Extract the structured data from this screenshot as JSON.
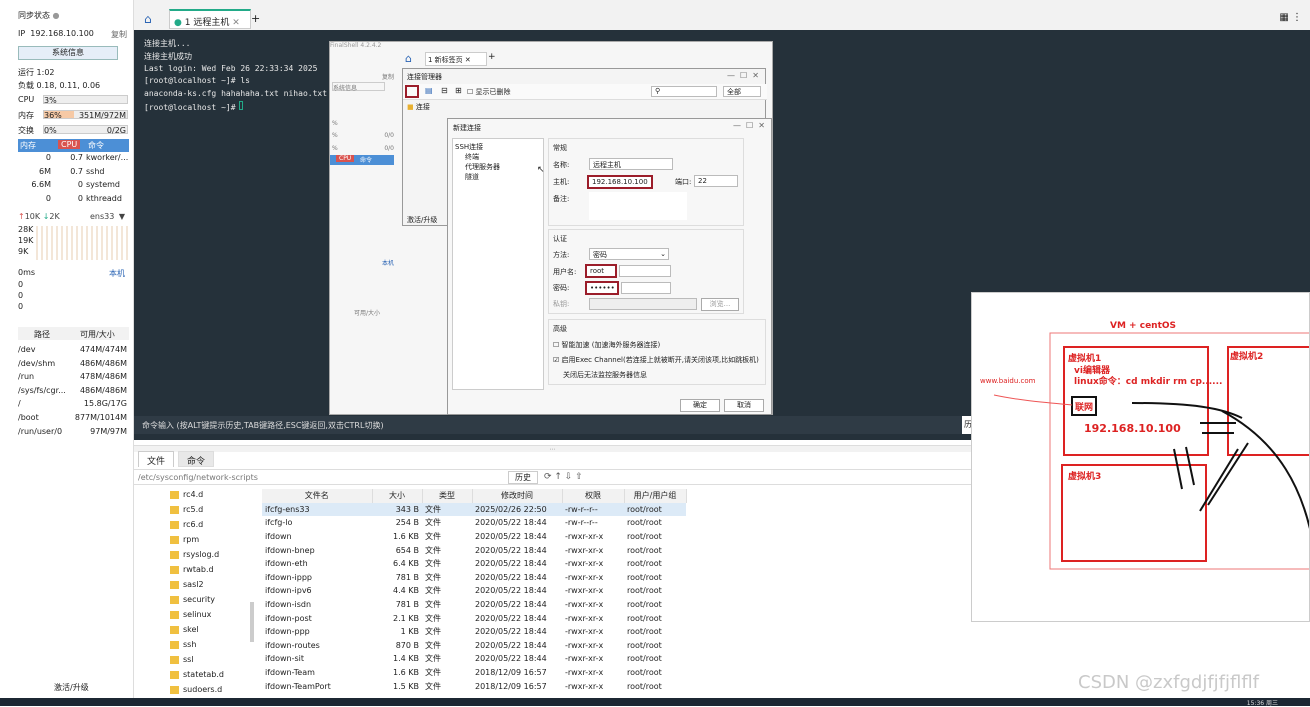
{
  "app": {
    "title": "FinalShell 4.2.4.2"
  },
  "sidebar": {
    "sync_label": "同步状态",
    "ip_label": "IP",
    "ip": "192.168.10.100",
    "copy": "复制",
    "sysinfo_button": "系统信息",
    "uptime": "运行 1:02",
    "load": "负载 0.18, 0.11, 0.06",
    "cpu_label": "CPU",
    "cpu_value": "3%",
    "cpu_fraction": 0.03,
    "mem_label": "内存",
    "mem_percent": "36%",
    "mem_value": "351M/972M",
    "mem_fraction": 0.36,
    "swap_label": "交换",
    "swap_percent": "0%",
    "swap_value": "0/2G",
    "proc_headers": [
      "内存",
      "CPU",
      "命令"
    ],
    "processes": [
      {
        "mem": "0",
        "cpu": "0.7",
        "cmd": "kworker/..."
      },
      {
        "mem": "6M",
        "cpu": "0.7",
        "cmd": "sshd"
      },
      {
        "mem": "6.6M",
        "cpu": "0",
        "cmd": "systemd"
      },
      {
        "mem": "0",
        "cpu": "0",
        "cmd": "kthreadd"
      }
    ],
    "net_up": "10K",
    "net_down": "2K",
    "net_iface": "ens33",
    "net_ticks": [
      "28K",
      "19K",
      "9K"
    ],
    "ping_label": "0ms",
    "ping_local": "本机",
    "ping_vals": [
      "0",
      "0",
      "0"
    ],
    "disk_headers": [
      "路径",
      "可用/大小"
    ],
    "disks": [
      {
        "path": "/dev",
        "size": "474M/474M"
      },
      {
        "path": "/dev/shm",
        "size": "486M/486M"
      },
      {
        "path": "/run",
        "size": "478M/486M"
      },
      {
        "path": "/sys/fs/cgr...",
        "size": "486M/486M"
      },
      {
        "path": "/",
        "size": "15.8G/17G"
      },
      {
        "path": "/boot",
        "size": "877M/1014M"
      },
      {
        "path": "/run/user/0",
        "size": "97M/97M"
      }
    ],
    "activate": "激活/升级"
  },
  "tabs": {
    "active": "1 远程主机"
  },
  "terminal": {
    "lines": [
      "连接主机...",
      "连接主机成功",
      "Last login: Wed Feb 26 22:33:34 2025",
      "[root@localhost ~]# ls",
      "anaconda-ks.cfg  hahahaha.txt  nihao.txt",
      "[root@localhost ~]#"
    ],
    "command_hint": "命令输入 (按ALT键提示历史,TAB键路径,ESC键返回,双击CTRL切换)"
  },
  "inner": {
    "title": "FinalShell 4.2.4.2",
    "tab": "1 新标签页",
    "sysinfo": "系统信息",
    "copy": "复制",
    "cpu_hdr": "CPU",
    "cmd_hdr": "命令",
    "local": "本机",
    "avail": "可用/大小",
    "pct": [
      "%",
      "%",
      "%"
    ],
    "zeros": [
      "0/0",
      "0/0"
    ]
  },
  "conn_mgr": {
    "title": "连接管理器",
    "show_deleted": "显示已删除",
    "filter": "全部",
    "folder": "连接",
    "activate": "激活/升级"
  },
  "new_conn": {
    "title": "新建连接",
    "tree": [
      "SSH连接",
      "终端",
      "代理服务器",
      "隧道"
    ],
    "general": "常规",
    "name_label": "名称:",
    "name_value": "远程主机",
    "host_label": "主机:",
    "host_value": "192.168.10.100",
    "port_label": "端口:",
    "port_value": "22",
    "remark_label": "备注:",
    "auth": "认证",
    "method_label": "方法:",
    "method_value": "密码",
    "user_label": "用户名:",
    "user_value": "root",
    "pass_label": "密码:",
    "pass_value": "••••••",
    "key_label": "私钥:",
    "browse": "浏览...",
    "advanced": "高级",
    "smart_accel": "智能加速 (加速海外服务器连接)",
    "exec_channel": "启用Exec Channel(若连接上就被断开,请关闭该项,比如跳板机)",
    "exec_note": "关闭后无法监控服务器信息",
    "ok": "确定",
    "cancel": "取消"
  },
  "files": {
    "tabs": [
      "文件",
      "命令"
    ],
    "path": "/etc/sysconfig/network-scripts",
    "history": "历史",
    "tree": [
      "rc4.d",
      "rc5.d",
      "rc6.d",
      "rpm",
      "rsyslog.d",
      "rwtab.d",
      "sasl2",
      "security",
      "selinux",
      "skel",
      "ssh",
      "ssl",
      "statetab.d",
      "sudoers.d"
    ],
    "headers": [
      "文件名",
      "大小",
      "类型",
      "修改时间",
      "权限",
      "用户/用户组"
    ],
    "rows": [
      [
        "ifcfg-ens33",
        "343 B",
        "文件",
        "2025/02/26 22:50",
        "-rw-r--r--",
        "root/root"
      ],
      [
        "ifcfg-lo",
        "254 B",
        "文件",
        "2020/05/22 18:44",
        "-rw-r--r--",
        "root/root"
      ],
      [
        "ifdown",
        "1.6 KB",
        "文件",
        "2020/05/22 18:44",
        "-rwxr-xr-x",
        "root/root"
      ],
      [
        "ifdown-bnep",
        "654 B",
        "文件",
        "2020/05/22 18:44",
        "-rwxr-xr-x",
        "root/root"
      ],
      [
        "ifdown-eth",
        "6.4 KB",
        "文件",
        "2020/05/22 18:44",
        "-rwxr-xr-x",
        "root/root"
      ],
      [
        "ifdown-ippp",
        "781 B",
        "文件",
        "2020/05/22 18:44",
        "-rwxr-xr-x",
        "root/root"
      ],
      [
        "ifdown-ipv6",
        "4.4 KB",
        "文件",
        "2020/05/22 18:44",
        "-rwxr-xr-x",
        "root/root"
      ],
      [
        "ifdown-isdn",
        "781 B",
        "文件",
        "2020/05/22 18:44",
        "-rwxr-xr-x",
        "root/root"
      ],
      [
        "ifdown-post",
        "2.1 KB",
        "文件",
        "2020/05/22 18:44",
        "-rwxr-xr-x",
        "root/root"
      ],
      [
        "ifdown-ppp",
        "1 KB",
        "文件",
        "2020/05/22 18:44",
        "-rwxr-xr-x",
        "root/root"
      ],
      [
        "ifdown-routes",
        "870 B",
        "文件",
        "2020/05/22 18:44",
        "-rwxr-xr-x",
        "root/root"
      ],
      [
        "ifdown-sit",
        "1.4 KB",
        "文件",
        "2020/05/22 18:44",
        "-rwxr-xr-x",
        "root/root"
      ],
      [
        "ifdown-Team",
        "1.6 KB",
        "文件",
        "2018/12/09 16:57",
        "-rwxr-xr-x",
        "root/root"
      ],
      [
        "ifdown-TeamPort",
        "1.5 KB",
        "文件",
        "2018/12/09 16:57",
        "-rwxr-xr-x",
        "root/root"
      ]
    ]
  },
  "whiteboard": {
    "title": "VM + centOS",
    "vm1": "虚拟机1",
    "vi": "vi编辑器",
    "linux": "linux命令：cd mkdir rm cp......",
    "net": "联网",
    "ip": "192.168.10.100",
    "vm2": "虚拟机2",
    "vm3": "虚拟机3",
    "baidu": "www.baidu.com"
  },
  "watermark": "CSDN @zxfgdjfjfjflflf",
  "clock": "15:36 周三"
}
